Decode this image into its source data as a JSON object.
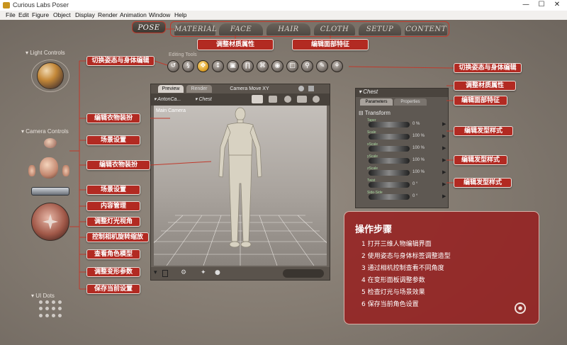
{
  "window": {
    "title": "Curious Labs Poser",
    "min_glyph": "—",
    "max_glyph": "☐",
    "close_glyph": "✕"
  },
  "menu": [
    "File",
    "Edit",
    "Figure",
    "Object",
    "Display",
    "Render",
    "Animation",
    "Window",
    "Help"
  ],
  "rooms": {
    "active": "POSE",
    "others": [
      "MATERIAL",
      "FACE",
      "HAIR",
      "CLOTH",
      "SETUP",
      "CONTENT"
    ]
  },
  "side_panels": {
    "light_controls": "Light Controls",
    "camera_controls": "Camera Controls",
    "ui_dots": "UI Dots"
  },
  "editing_tools_label": "Editing Tools",
  "viewport": {
    "tabs": [
      "Preview",
      "Render"
    ],
    "camera_label": "Camera Move XY",
    "figure_select": "AntonCa...",
    "part_select": "Chest",
    "camera_name": "Main Camera"
  },
  "parameters_panel": {
    "title": "Chest",
    "tabs": [
      "Parameters",
      "Properties"
    ],
    "group": "Transform",
    "rows": [
      {
        "name": "Taper",
        "value": "0 %"
      },
      {
        "name": "Scale",
        "value": "100 %"
      },
      {
        "name": "xScale",
        "value": "100 %"
      },
      {
        "name": "yScale",
        "value": "100 %"
      },
      {
        "name": "zScale",
        "value": "100 %"
      },
      {
        "name": "Twist",
        "value": "0 °"
      },
      {
        "name": "Side-Side",
        "value": "0 °"
      }
    ]
  },
  "annotations": {
    "top_material": "调整材质属性",
    "top_face": "编辑面部特征",
    "left": [
      "切换姿态与身体编辑",
      "编辑衣物装扮",
      "场景设置",
      "编辑衣物装扮",
      "场景设置",
      "内容管理",
      "调整灯光视角",
      "控制相机旋转缩放",
      "查看角色模型",
      "调整变形参数",
      "保存当前设置"
    ],
    "right": [
      "切换姿态与身体编辑",
      "调整材质属性",
      "编辑面部特征",
      "编辑发型样式",
      "编辑发型样式",
      "编辑发型样式"
    ]
  },
  "steps_panel": {
    "title": "操作步骤",
    "steps": [
      "1 打开三维人物编辑界面",
      "2 使用姿态与身体标签调整造型",
      "3 通过相机控制查看不同角度",
      "4 在变形面板调整参数",
      "5 检查灯光与场景效果",
      "6 保存当前角色设置"
    ]
  },
  "colors": {
    "annotation_red": "#b22a22",
    "panel_red": "#961e1e"
  }
}
